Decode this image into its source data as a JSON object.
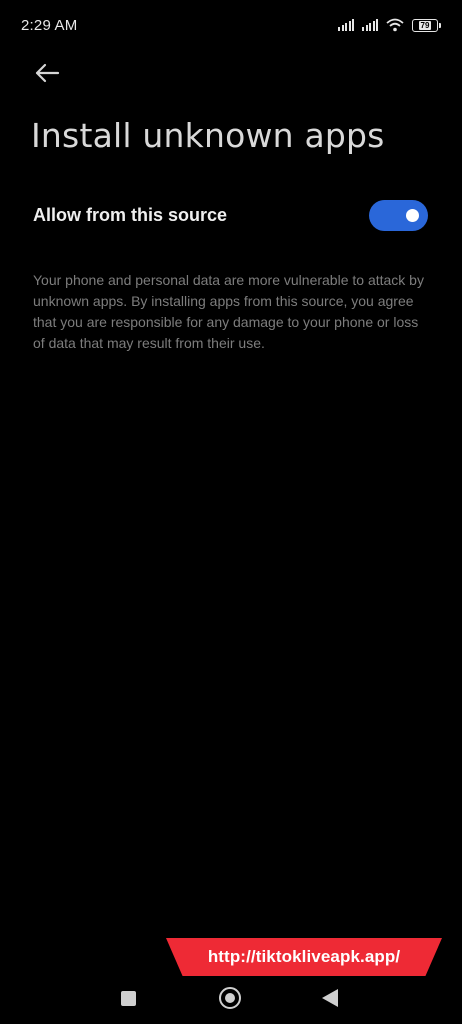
{
  "status_bar": {
    "time": "2:29 AM",
    "icons": [
      "signal-icon",
      "signal-icon",
      "wifi-icon",
      "battery-icon"
    ],
    "battery_level": "79"
  },
  "header": {
    "back_icon": "arrow-left-icon",
    "title": "Install unknown apps"
  },
  "setting": {
    "label": "Allow from this source",
    "toggle_state": "on",
    "toggle_color": "#2a67d9"
  },
  "description": "Your phone and personal data are more vulnerable to attack by unknown apps. By installing apps from this source, you agree that you are responsible for any damage to your phone or loss of data that may result from their use.",
  "watermark": {
    "text": "http://tiktokliveapk.app/",
    "color": "#ee2a35"
  },
  "nav_bar": {
    "icons": [
      "recents-icon",
      "home-icon",
      "back-icon"
    ]
  }
}
